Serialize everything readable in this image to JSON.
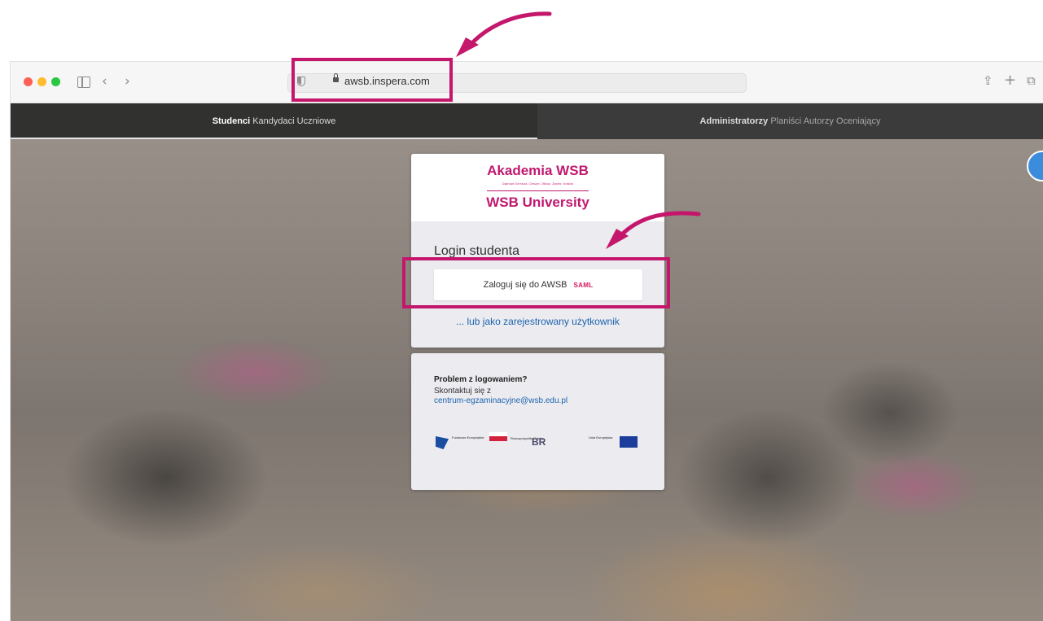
{
  "browser": {
    "url": "awsb.inspera.com"
  },
  "nav": {
    "left_bold": "Studenci",
    "left_rest": " Kandydaci Uczniowe",
    "right_bold": "Administratorzy",
    "right_rest": " Planiści Autorzy Oceniający"
  },
  "logo": {
    "line1": "Akademia WSB",
    "subtitle": "Dąbrowa Górnicza, Cieszyn, Olkusz, Żywiec, Kraków",
    "line2": "WSB University"
  },
  "login": {
    "heading": "Login studenta",
    "saml_button_label": "Zaloguj się do AWSB",
    "saml_logo_text": "SAML",
    "alt_link": "... lub jako zarejestrowany użytkownik"
  },
  "help": {
    "title": "Problem z logowaniem?",
    "text": "Skontaktuj się z",
    "email": "centrum-egzaminacyjne@wsb.edu.pl"
  },
  "eu_logos": {
    "fe": "Fundusze Europejskie",
    "pl": "Rzeczpospolita Polska",
    "br": "BR",
    "ue": "Unia Europejska"
  },
  "colors": {
    "brand": "#c1186f",
    "highlight": "#c4176c",
    "link": "#1e64ad"
  }
}
